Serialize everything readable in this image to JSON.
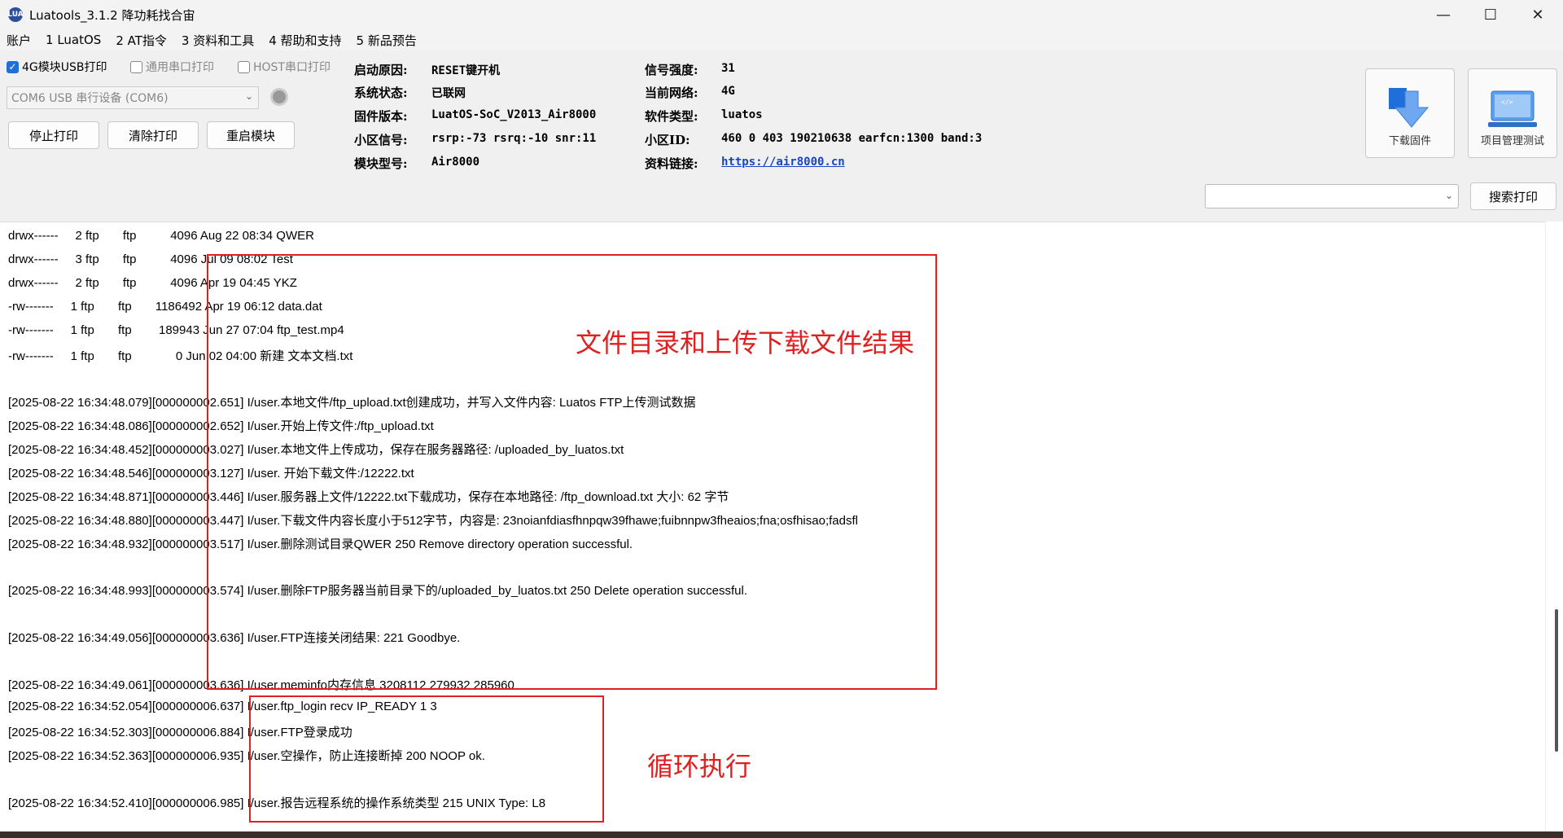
{
  "window": {
    "title": "Luatools_3.1.2 降功耗找合宙",
    "icon_text": "LUA",
    "controls": {
      "minimize": "—",
      "maximize": "☐",
      "close": "✕"
    }
  },
  "menu": [
    "账户",
    "1 LuatOS",
    "2 AT指令",
    "3 资料和工具",
    "4 帮助和支持",
    "5 新品预告"
  ],
  "options": {
    "usb_print": {
      "label": "4G模块USB打印",
      "checked": true
    },
    "serial_print": {
      "label": "通用串口打印",
      "checked": false
    },
    "host_print": {
      "label": "HOST串口打印",
      "checked": false
    }
  },
  "port_select": {
    "value": "COM6 USB 串行设备 (COM6)"
  },
  "buttons": {
    "stop": "停止打印",
    "clear": "清除打印",
    "restart": "重启模块",
    "search": "搜索打印",
    "download_fw": "下载固件",
    "project_test": "项目管理测试"
  },
  "info": {
    "boot_reason": {
      "label": "启动原因:",
      "value": "RESET键开机"
    },
    "system_status": {
      "label": "系统状态:",
      "value": "已联网"
    },
    "firmware": {
      "label": "固件版本:",
      "value": "LuatOS-SoC_V2013_Air8000"
    },
    "cell_signal": {
      "label": "小区信号:",
      "value": "rsrp:-73 rsrq:-10 snr:11"
    },
    "module_model": {
      "label": "模块型号:",
      "value": "Air8000"
    },
    "signal_strength": {
      "label": "信号强度:",
      "value": "31"
    },
    "network": {
      "label": "当前网络:",
      "value": "4G"
    },
    "software_type": {
      "label": "软件类型:",
      "value": "luatos"
    },
    "cell_id": {
      "label": "小区ID:",
      "value": "460 0 403 190210638 earfcn:1300 band:3"
    },
    "doc_link": {
      "label": "资料链接:",
      "value": "https://air8000.cn"
    }
  },
  "log_lines": [
    "drwx------     2 ftp       ftp          4096 Aug 22 08:34 QWER",
    "drwx------     3 ftp       ftp          4096 Jul 09 08:02 Test",
    "drwx------     2 ftp       ftp          4096 Apr 19 04:45 YKZ",
    "-rw-------     1 ftp       ftp       1186492 Apr 19 06:12 data.dat",
    "-rw-------     1 ftp       ftp        189943 Jun 27 07:04 ftp_test.mp4",
    "-rw-------     1 ftp       ftp             0 Jun 02 04:00 新建 文本文档.txt",
    "",
    "[2025-08-22 16:34:48.079][000000002.651] I/user.本地文件/ftp_upload.txt创建成功，并写入文件内容: Luatos FTP上传测试数据",
    "[2025-08-22 16:34:48.086][000000002.652] I/user.开始上传文件:/ftp_upload.txt",
    "[2025-08-22 16:34:48.452][000000003.027] I/user.本地文件上传成功，保存在服务器路径: /uploaded_by_luatos.txt",
    "[2025-08-22 16:34:48.546][000000003.127] I/user. 开始下载文件:/12222.txt",
    "[2025-08-22 16:34:48.871][000000003.446] I/user.服务器上文件/12222.txt下载成功，保存在本地路径: /ftp_download.txt 大小: 62 字节",
    "[2025-08-22 16:34:48.880][000000003.447] I/user.下载文件内容长度小于512字节，内容是: 23noianfdiasfhnpqw39fhawe;fuibnnpw3fheaios;fna;osfhisao;fadsfl",
    "[2025-08-22 16:34:48.932][000000003.517] I/user.删除测试目录QWER 250 Remove directory operation successful.",
    "",
    "[2025-08-22 16:34:48.993][000000003.574] I/user.删除FTP服务器当前目录下的/uploaded_by_luatos.txt 250 Delete operation successful.",
    "",
    "[2025-08-22 16:34:49.056][000000003.636] I/user.FTP连接关闭结果: 221 Goodbye.",
    "",
    "[2025-08-22 16:34:49.061][000000003.636] I/user.meminfo内存信息 3208112 279932 285960",
    "[2025-08-22 16:34:52.054][000000006.637] I/user.ftp_login recv IP_READY 1 3",
    "[2025-08-22 16:34:52.303][000000006.884] I/user.FTP登录成功",
    "[2025-08-22 16:34:52.363][000000006.935] I/user.空操作，防止连接断掉 200 NOOP ok.",
    "",
    "[2025-08-22 16:34:52.410][000000006.985] I/user.报告远程系统的操作系统类型 215 UNIX Type: L8"
  ],
  "annotations": {
    "result_label": "文件目录和上传下载文件结果",
    "loop_label": "循环执行",
    "color": "#e02020"
  }
}
